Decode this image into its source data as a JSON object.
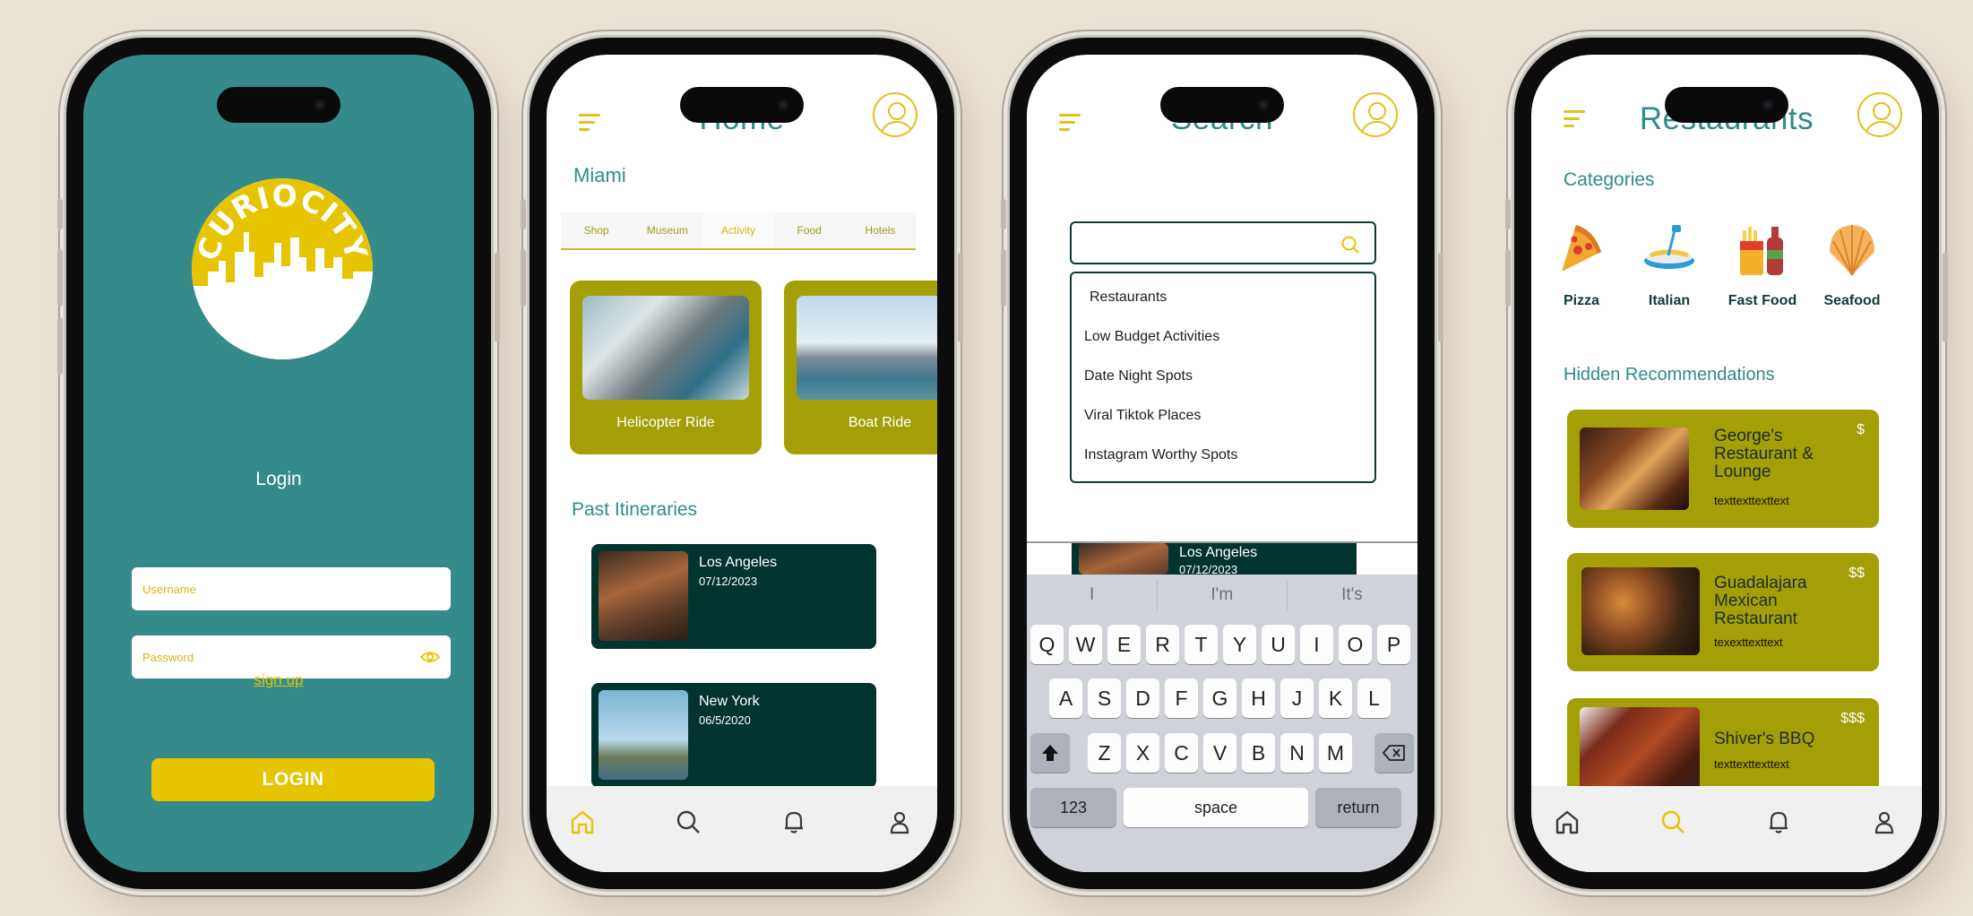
{
  "login": {
    "logo_text": "CURIOCITY",
    "title": "Login",
    "username_placeholder": "Username",
    "password_placeholder": "Password",
    "signup": "sign up",
    "button": "LOGIN"
  },
  "home": {
    "title": "Home",
    "city": "Miami",
    "tabs": [
      "Shop",
      "Museum",
      "Activity",
      "Food",
      "Hotels"
    ],
    "activities": [
      {
        "label": "Helicopter Ride"
      },
      {
        "label": "Boat Ride"
      }
    ],
    "past_title": "Past Itineraries",
    "itineraries": [
      {
        "city": "Los Angeles",
        "date": "07/12/2023"
      },
      {
        "city": "New York",
        "date": "06/5/2020"
      }
    ]
  },
  "search": {
    "title": "Search",
    "dropdown": [
      "Restaurants",
      "Low Budget Activities",
      "Date Night Spots",
      "Viral Tiktok Places",
      "Instagram Worthy Spots"
    ],
    "peek_card": {
      "city": "Los Angeles",
      "date": "07/12/2023"
    },
    "suggestions": [
      "I",
      "I'm",
      "It's"
    ],
    "row1": [
      "Q",
      "W",
      "E",
      "R",
      "T",
      "Y",
      "U",
      "I",
      "O",
      "P"
    ],
    "row2": [
      "A",
      "S",
      "D",
      "F",
      "G",
      "H",
      "J",
      "K",
      "L"
    ],
    "row3": [
      "Z",
      "X",
      "C",
      "V",
      "B",
      "N",
      "M"
    ],
    "key_123": "123",
    "key_space": "space",
    "key_return": "return"
  },
  "restaurants": {
    "title": "Restaurants",
    "categories_title": "Categories",
    "categories": [
      "Pizza",
      "Italian",
      "Fast Food",
      "Seafood"
    ],
    "hidden_title": "Hidden Recommendations",
    "items": [
      {
        "name": "George's Restaurant & Lounge",
        "text": "texttexttexttext",
        "price": "$"
      },
      {
        "name": "Guadalajara Mexican Restaurant",
        "text": "texexttexttext",
        "price": "$$"
      },
      {
        "name": "Shiver's BBQ",
        "text": "texttexttexttext",
        "price": "$$$"
      }
    ]
  },
  "colors": {
    "teal": "#348b8a",
    "gold": "#e6c400",
    "olive": "#a39f06",
    "dark_green": "#02342f"
  }
}
